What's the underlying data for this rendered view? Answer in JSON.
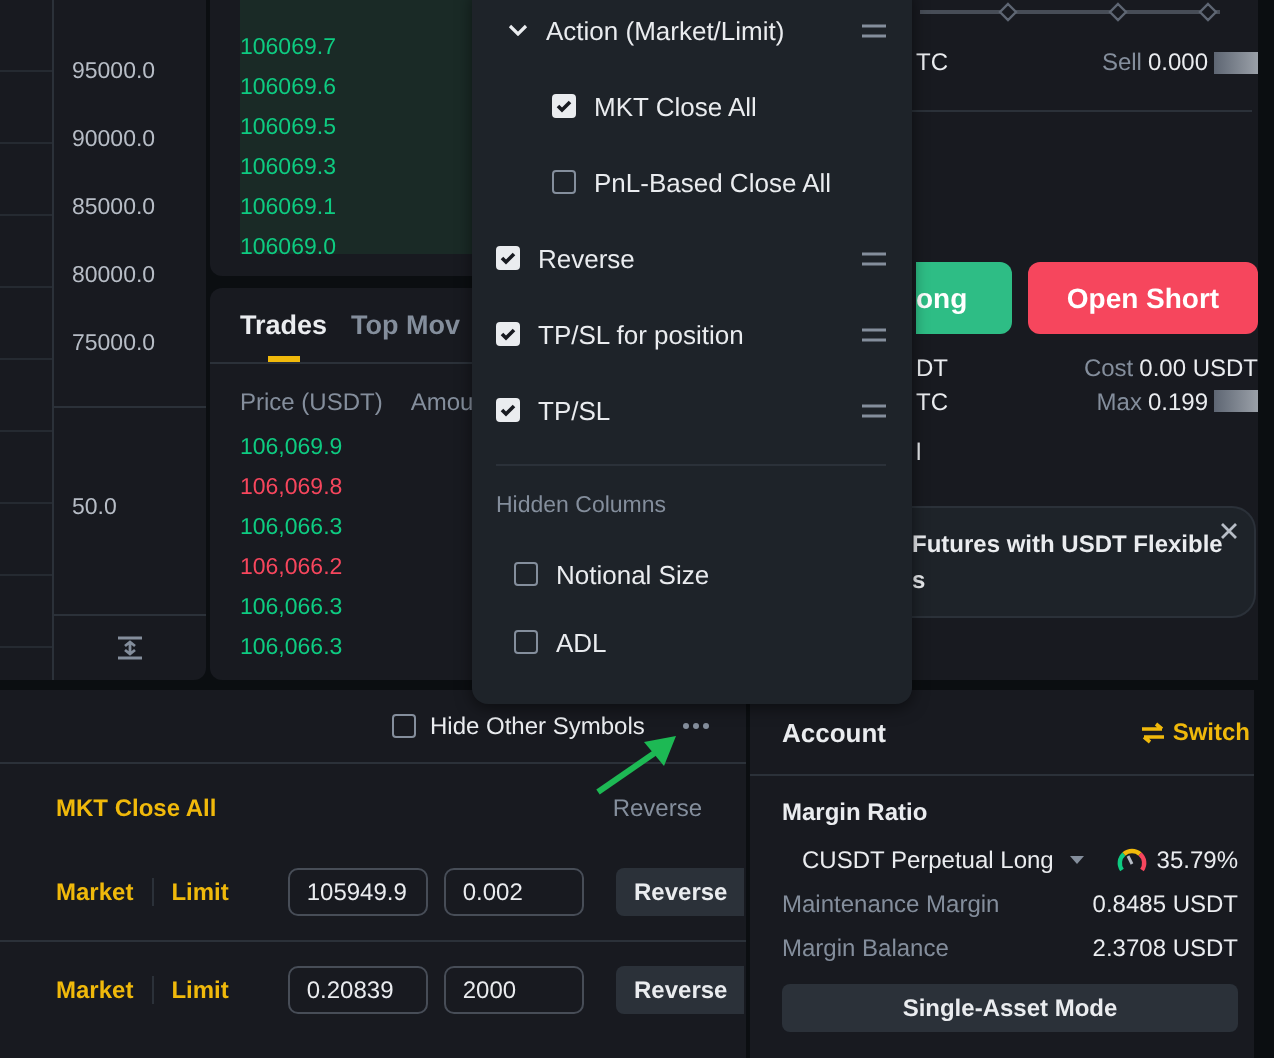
{
  "chart": {
    "price_axis": [
      "95000.0",
      "90000.0",
      "85000.0",
      "80000.0",
      "75000.0"
    ],
    "volume_axis": [
      "50.0"
    ]
  },
  "order_book": {
    "asks": [
      "106069.7",
      "106069.6",
      "106069.5",
      "106069.3",
      "106069.1",
      "106069.0"
    ]
  },
  "trades": {
    "tabs": [
      {
        "label": "Trades",
        "selected": true
      },
      {
        "label": "Top Mov",
        "selected": false
      }
    ],
    "columns": [
      "Price (USDT)",
      "Amou"
    ],
    "rows": [
      {
        "price": "106,069.9",
        "color": "#0ecb81"
      },
      {
        "price": "106,069.8",
        "color": "#f6465d"
      },
      {
        "price": "106,066.3",
        "color": "#0ecb81"
      },
      {
        "price": "106,066.2",
        "color": "#f6465d"
      },
      {
        "price": "106,066.3",
        "color": "#0ecb81"
      },
      {
        "price": "106,066.3",
        "color": "#0ecb81"
      }
    ]
  },
  "order_panel": {
    "unit": "TC",
    "sell_label": "Sell",
    "sell_value": "0.000",
    "buttons": [
      {
        "label": "ong",
        "kind": "long"
      },
      {
        "label": "Open Short",
        "kind": "short"
      }
    ],
    "info": [
      {
        "left": "DT",
        "label": "Cost",
        "value": "0.00 USDT",
        "redacted": false
      },
      {
        "left": "TC",
        "label": "Max",
        "value": "0.199",
        "redacted": true
      }
    ],
    "fragment": "l",
    "banner": [
      "Futures with USDT Flexible",
      "s"
    ]
  },
  "positions": {
    "hide_other_symbols": {
      "label": "Hide Other Symbols",
      "checked": false
    },
    "columns": [
      "MKT Close All",
      "Reverse"
    ],
    "rows": [
      {
        "market": "Market",
        "limit": "Limit",
        "price": "105949.9",
        "amount": "0.002",
        "action": "Reverse"
      },
      {
        "market": "Market",
        "limit": "Limit",
        "price": "0.20839",
        "amount": "2000",
        "action": "Reverse"
      }
    ]
  },
  "account": {
    "title": "Account",
    "switch": "Switch",
    "margin_title": "Margin Ratio",
    "symbol": "CUSDT Perpetual Long",
    "ratio": "35.79%",
    "rows": [
      {
        "label": "Maintenance Margin",
        "value": "0.8485 USDT"
      },
      {
        "label": "Margin Balance",
        "value": "2.3708 USDT"
      }
    ],
    "mode_button": "Single-Asset Mode"
  },
  "column_menu": {
    "items": [
      {
        "kind": "group",
        "label": "Action (Market/Limit)",
        "expanded": true,
        "children": [
          {
            "label": "MKT Close All",
            "checked": true
          },
          {
            "label": "PnL-Based Close All",
            "checked": false
          }
        ]
      },
      {
        "kind": "item",
        "label": "Reverse",
        "checked": true
      },
      {
        "kind": "item",
        "label": "TP/SL for position",
        "checked": true
      },
      {
        "kind": "item",
        "label": "TP/SL",
        "checked": true
      }
    ],
    "hidden_title": "Hidden Columns",
    "hidden": [
      {
        "label": "Notional Size",
        "checked": false
      },
      {
        "label": "ADL",
        "checked": false
      }
    ]
  }
}
